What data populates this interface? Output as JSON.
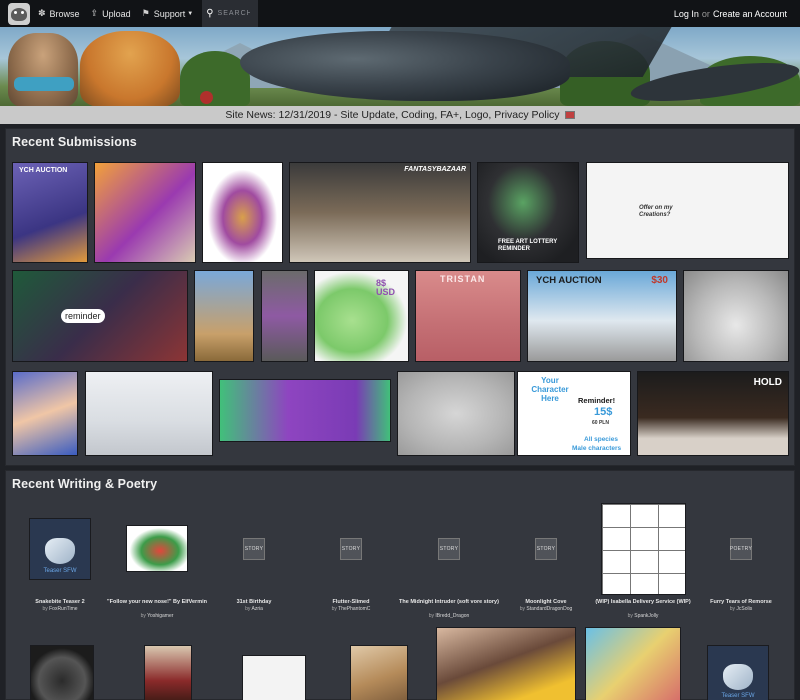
{
  "nav": {
    "browse": "Browse",
    "upload": "Upload",
    "support": "Support",
    "search_placeholder": "SEARCH",
    "login": "Log In",
    "or": "or",
    "create_account": "Create an Account"
  },
  "news": {
    "text": "Site News: 12/31/2019 - Site Update, Coding, FA+, Logo, Privacy Policy"
  },
  "recent_submissions": {
    "title": "Recent Submissions",
    "labels": {
      "ych_auction": "YCH AUCTION",
      "fantasybazaar": "FANTASYBAZAAR",
      "lottery": "FREE ART LOTTERY REMINDER",
      "offer": "Offer on my Creations?",
      "reminder": "reminder",
      "eight_usd": "8$ USD",
      "tristan": "TRISTAN",
      "ych_auction2": "YCH AUCTION",
      "thirty": "$30",
      "hold": "HOLD",
      "your_character": "Your Character Here",
      "reminder2": "Reminder!",
      "fifteen": "15$",
      "pln": "60 PLN",
      "all_species": "All species",
      "male_chars": "Male characters"
    }
  },
  "recent_writing": {
    "title": "Recent Writing & Poetry",
    "items": [
      {
        "title": "Snakebite Teaser 2",
        "by": "by",
        "author": "FoxRunTime",
        "thumb": "Teaser SFW"
      },
      {
        "title": "\"Follow your new nose!\" By ElfVermin",
        "by": "by",
        "author": "Yoshigamer"
      },
      {
        "title": "31st Birthday",
        "by": "by",
        "author": "Azria",
        "thumb": "STORY"
      },
      {
        "title": "Flutter-Slimed",
        "by": "by",
        "author": "ThePhantomC",
        "thumb": "STORY"
      },
      {
        "title": "The Midnight Intruder (soft vore story)",
        "by": "by",
        "author": "IBredd_Dragon",
        "thumb": "STORY"
      },
      {
        "title": "Moonlight Cove",
        "by": "by",
        "author": "StandardDragonDog",
        "thumb": "STORY"
      },
      {
        "title": "(WIP) Isabella Delivery Service (WIP)",
        "by": "by",
        "author": "SpankJolly"
      },
      {
        "title": "Furry Tears of Remorse",
        "by": "by",
        "author": "JcSolis",
        "thumb": "POETRY"
      }
    ],
    "bottom_thumb": "Teaser SFW"
  }
}
